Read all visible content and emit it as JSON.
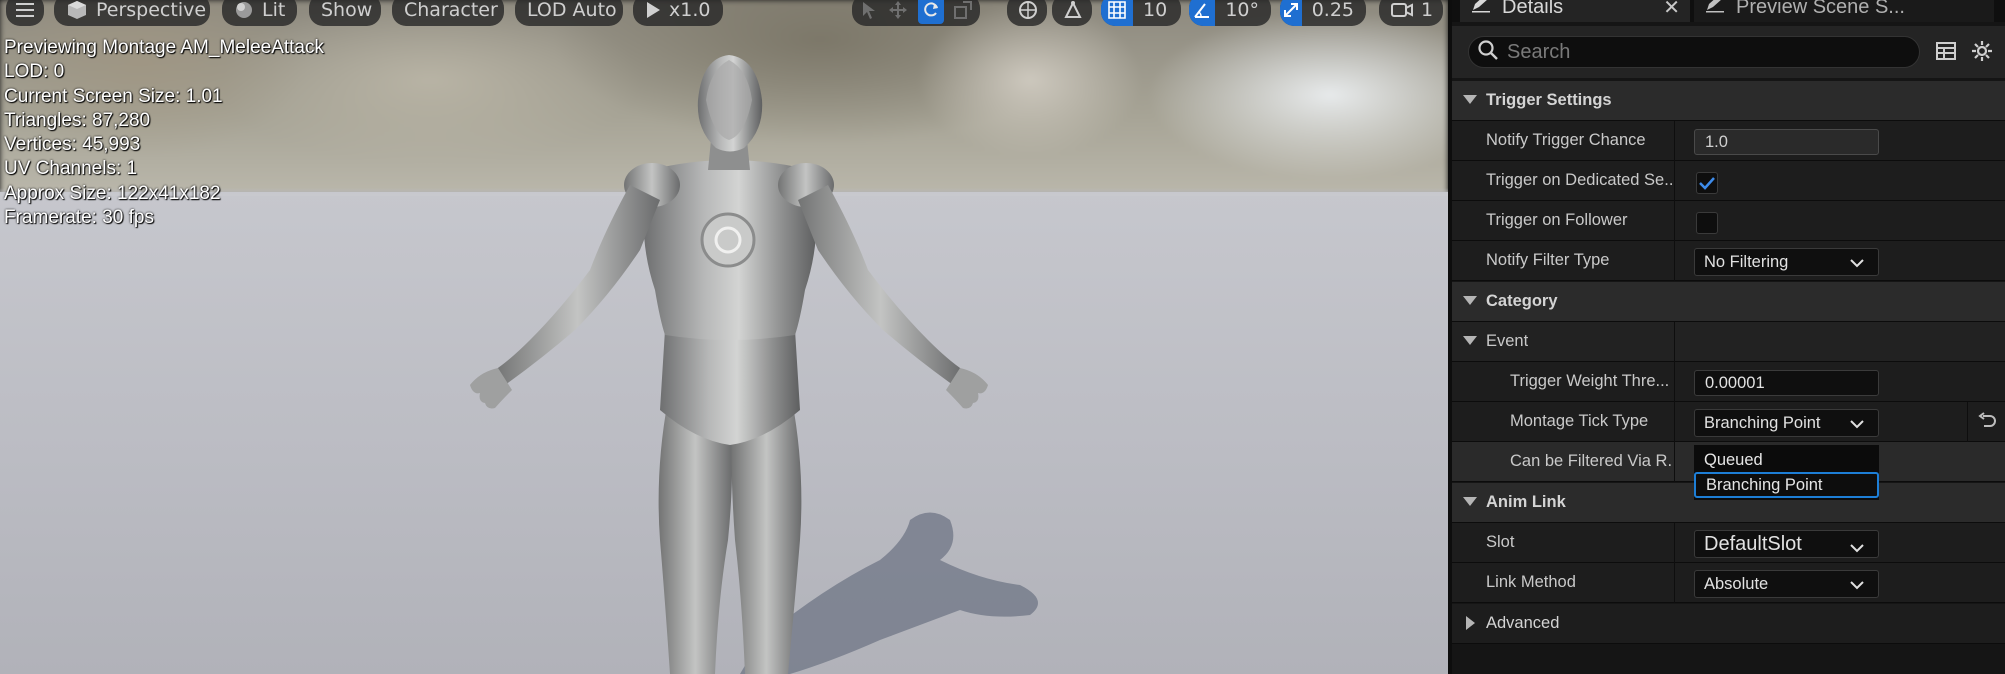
{
  "viewport": {
    "toolbar": {
      "perspective": "Perspective",
      "lit": "Lit",
      "show": "Show",
      "character": "Character",
      "lod": "LOD Auto",
      "play_speed": "x1.0",
      "grid_snap": "10",
      "rotation_snap": "10°",
      "scale_snap": "0.25",
      "camera_speed": "1"
    },
    "stats": [
      "Previewing Montage AM_MeleeAttack",
      "LOD: 0",
      "Current Screen Size: 1.01",
      "Triangles: 87,280",
      "Vertices: 45,993",
      "UV Channels: 1",
      "Approx Size: 122x41x182",
      "Framerate: 30 fps"
    ]
  },
  "details": {
    "tabs": {
      "active": "Details",
      "inactive": "Preview Scene S..."
    },
    "search_placeholder": "Search",
    "trigger_settings": {
      "title": "Trigger Settings",
      "notify_trigger_chance_label": "Notify Trigger Chance",
      "notify_trigger_chance_value": "1.0",
      "trigger_dedicated_label": "Trigger on Dedicated Se...",
      "trigger_dedicated_checked": true,
      "trigger_follower_label": "Trigger on Follower",
      "trigger_follower_checked": false,
      "notify_filter_label": "Notify Filter Type",
      "notify_filter_value": "No Filtering"
    },
    "category": {
      "title": "Category",
      "event_title": "Event",
      "trigger_weight_label": "Trigger Weight Thre...",
      "trigger_weight_value": "0.00001",
      "montage_tick_label": "Montage Tick Type",
      "montage_tick_value": "Branching Point",
      "filtered_label": "Can be Filtered Via R...",
      "dropdown_options": [
        "Queued",
        "Branching Point"
      ]
    },
    "anim_link": {
      "title": "Anim Link",
      "slot_label": "Slot",
      "slot_value": "DefaultSlot",
      "link_method_label": "Link Method",
      "link_method_value": "Absolute"
    },
    "advanced": {
      "title": "Advanced"
    }
  },
  "colors": {
    "accent": "#1f6fd1",
    "panel_bg": "#151515",
    "selection": "#1d7ed6"
  }
}
